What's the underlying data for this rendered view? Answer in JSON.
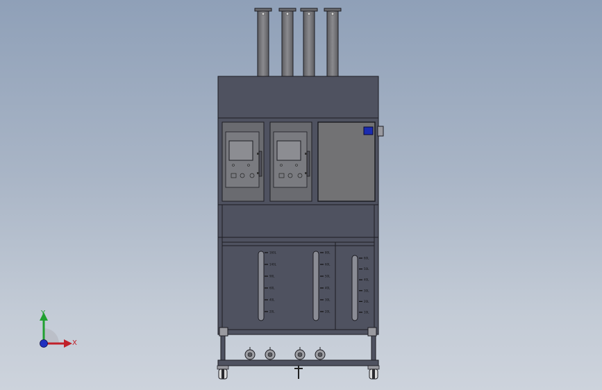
{
  "viewport": {
    "background_top": "#8fa0b8",
    "background_bottom": "#cdd3dc"
  },
  "model": {
    "body_color": "#4f5260",
    "panel_color": "#6a6b70",
    "door_color": "#727274",
    "outline_color": "#1c1c22",
    "pipe_color": "#7c7c80",
    "tank_color": "#505465",
    "sight_glass_color": "#8a8c95",
    "indicator_color": "#1a2bb0",
    "tanks": [
      {
        "id": "left",
        "scale_labels": [
          "160L",
          "140L",
          "90L",
          "60L",
          "40L",
          "20L"
        ]
      },
      {
        "id": "middle",
        "scale_labels": [
          "80L",
          "60L",
          "50L",
          "40L",
          "30L",
          "20L"
        ]
      },
      {
        "id": "right",
        "scale_labels": [
          "60L",
          "50L",
          "40L",
          "30L",
          "20L",
          "10L"
        ]
      }
    ],
    "pumps": [
      "pump-1",
      "pump-2",
      "pump-3",
      "pump-4"
    ]
  },
  "triad": {
    "x_label": "X",
    "y_label": "Y",
    "x_color": "#c0202a",
    "y_color": "#20a030",
    "z_color": "#2030c0"
  }
}
